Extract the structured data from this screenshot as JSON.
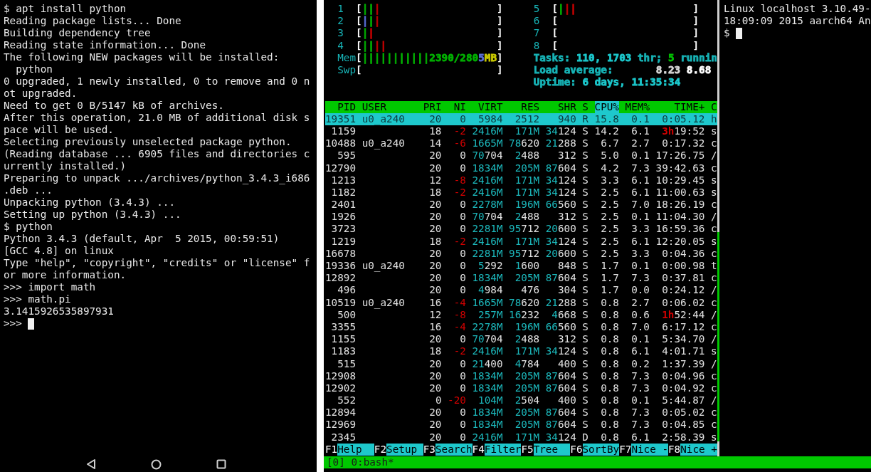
{
  "phone_terminal": {
    "lines": [
      "$ apt install python",
      "Reading package lists... Done",
      "Building dependency tree",
      "Reading state information... Done",
      "The following NEW packages will be installed:",
      "  python",
      "0 upgraded, 1 newly installed, 0 to remove and 0 n",
      "ot upgraded.",
      "Need to get 0 B/5147 kB of archives.",
      "After this operation, 21.0 MB of additional disk s",
      "pace will be used.",
      "Selecting previously unselected package python.",
      "(Reading database ... 6905 files and directories c",
      "urrently installed.)",
      "Preparing to unpack .../archives/python_3.4.3_i686",
      ".deb ...",
      "Unpacking python (3.4.3) ...",
      "Setting up python (3.4.3) ...",
      "$ python",
      "Python 3.4.3 (default, Apr  5 2015, 00:59:51)",
      "[GCC 4.8] on linux",
      "Type \"help\", \"copyright\", \"credits\" or \"license\" f",
      "or more information.",
      ">>> import math",
      ">>> math.pi",
      "3.1415926535897931"
    ],
    "prompt": ">>>"
  },
  "htop": {
    "meters_left": [
      {
        "label": "1",
        "open": "[",
        "close": "]",
        "segments": [
          {
            "text": "||",
            "color": "#00b000"
          },
          {
            "text": "|",
            "color": "#c00000"
          }
        ]
      },
      {
        "label": "2",
        "open": "[",
        "close": "]",
        "segments": [
          {
            "text": "|",
            "color": "#5a6ed8"
          },
          {
            "text": "|",
            "color": "#00b000"
          },
          {
            "text": "|",
            "color": "#c00000"
          }
        ]
      },
      {
        "label": "3",
        "open": "[",
        "close": "]",
        "segments": [
          {
            "text": "|",
            "color": "#00b000"
          },
          {
            "text": "|",
            "color": "#c00000"
          }
        ]
      },
      {
        "label": "4",
        "open": "[",
        "close": "]",
        "segments": [
          {
            "text": "||",
            "color": "#00b000"
          },
          {
            "text": "||",
            "color": "#c00000"
          }
        ]
      },
      {
        "label": "Mem",
        "open": "[",
        "close": "]",
        "segments": [
          {
            "text": "|||||||||||2390/280",
            "color": "#00b000"
          },
          {
            "text": "5",
            "color": "#5a6ed8"
          },
          {
            "text": "MB",
            "color": "#c8c800"
          }
        ]
      },
      {
        "label": "Swp",
        "open": "[",
        "close": "]"
      }
    ],
    "meters_right": [
      {
        "label": "5",
        "open": "[",
        "close": "]",
        "segments": [
          {
            "text": "|",
            "color": "#00b000"
          },
          {
            "text": "|",
            "color": "#c00000"
          },
          {
            "text": "|",
            "color": "#c00000"
          }
        ]
      },
      {
        "label": "6",
        "open": "[",
        "close": "]"
      },
      {
        "label": "7",
        "open": "[",
        "close": "]"
      },
      {
        "label": "8",
        "open": "[",
        "close": "]"
      }
    ],
    "summary": [
      {
        "segments": [
          {
            "text": "Tasks: ",
            "color": "#17b3b6"
          },
          {
            "text": "110, 1703",
            "color": "#1cc8cc"
          },
          {
            "text": " thr; ",
            "color": "#17b3b6"
          },
          {
            "text": "5",
            "color": "#00c000"
          },
          {
            "text": " runnin",
            "color": "#17b3b6"
          }
        ]
      },
      {
        "segments": [
          {
            "text": "Load average: ",
            "color": "#17b3b6"
          },
          {
            "text": "      8.23 ",
            "color": "#d8d8d8"
          },
          {
            "text": "8.68",
            "color": "#ffffff"
          }
        ]
      },
      {
        "segments": [
          {
            "text": "Uptime: ",
            "color": "#17b3b6"
          },
          {
            "text": "6 days, 11:35:34",
            "color": "#1cc8cc"
          }
        ]
      }
    ],
    "table": {
      "columns": [
        {
          "label": "PID",
          "selected": false
        },
        {
          "label": "USER",
          "selected": false
        },
        {
          "label": "PRI",
          "selected": false
        },
        {
          "label": "NI",
          "selected": false
        },
        {
          "label": "VIRT",
          "selected": false
        },
        {
          "label": "RES",
          "selected": false
        },
        {
          "label": "SHR",
          "selected": false
        },
        {
          "label": "S",
          "selected": false
        },
        {
          "label": "CPU%",
          "selected": true
        },
        {
          "label": "MEM%",
          "selected": false
        },
        {
          "label": "TIME+",
          "selected": false
        },
        {
          "label": "C",
          "selected": false
        }
      ],
      "rows": [
        {
          "pid": "19351",
          "user": "u0_a240",
          "pri": "20",
          "ni": "0",
          "virt": "5984",
          "res": "2512",
          "shr": "940",
          "state": "R",
          "cpu": "15.8",
          "mem": "0.1",
          "time": "0:05.12",
          "column_12": "h",
          "selected": true
        },
        {
          "pid": "1159",
          "pri": "18",
          "ni": "-2",
          "virt": "2416M",
          "res": "171M",
          "shr": "34124",
          "state": "S",
          "cpu": "14.2",
          "mem": "6.1",
          "time": "3h19:52",
          "column_12": "s",
          "selected": false
        },
        {
          "pid": "10488",
          "user": "u0_a240",
          "pri": "14",
          "ni": "-6",
          "virt": "1665M",
          "res": "78620",
          "shr": "21288",
          "state": "S",
          "cpu": "6.7",
          "mem": "2.7",
          "time": "0:17.32",
          "column_12": "c",
          "selected": false
        },
        {
          "pid": "595",
          "pri": "20",
          "ni": "0",
          "virt": "70704",
          "res": "2488",
          "shr": "312",
          "state": "S",
          "cpu": "5.0",
          "mem": "0.1",
          "time": "17:26.75",
          "column_12": "/",
          "selected": false
        },
        {
          "pid": "12790",
          "pri": "20",
          "ni": "0",
          "virt": "1834M",
          "res": "205M",
          "shr": "87604",
          "state": "S",
          "cpu": "4.2",
          "mem": "7.3",
          "time": "39:42.63",
          "column_12": "c",
          "selected": false
        },
        {
          "pid": "1213",
          "pri": "12",
          "ni": "-8",
          "virt": "2416M",
          "res": "171M",
          "shr": "34124",
          "state": "S",
          "cpu": "3.3",
          "mem": "6.1",
          "time": "10:29.45",
          "column_12": "s",
          "selected": false
        },
        {
          "pid": "1182",
          "pri": "18",
          "ni": "-2",
          "virt": "2416M",
          "res": "171M",
          "shr": "34124",
          "state": "S",
          "cpu": "2.5",
          "mem": "6.1",
          "time": "11:00.63",
          "column_12": "s",
          "selected": false
        },
        {
          "pid": "2401",
          "pri": "20",
          "ni": "0",
          "virt": "2278M",
          "res": "196M",
          "shr": "66560",
          "state": "S",
          "cpu": "2.5",
          "mem": "7.0",
          "time": "18:26.19",
          "column_12": "c",
          "selected": false
        },
        {
          "pid": "1926",
          "pri": "20",
          "ni": "0",
          "virt": "70704",
          "res": "2488",
          "shr": "312",
          "state": "S",
          "cpu": "2.5",
          "mem": "0.1",
          "time": "11:04.30",
          "column_12": "/",
          "selected": false
        },
        {
          "pid": "3723",
          "pri": "20",
          "ni": "0",
          "virt": "2281M",
          "res": "95712",
          "shr": "20600",
          "state": "S",
          "cpu": "2.5",
          "mem": "3.3",
          "time": "16:59.36",
          "column_12": "c",
          "selected": false
        },
        {
          "pid": "1219",
          "pri": "18",
          "ni": "-2",
          "virt": "2416M",
          "res": "171M",
          "shr": "34124",
          "state": "S",
          "cpu": "2.5",
          "mem": "6.1",
          "time": "12:20.05",
          "column_12": "s",
          "selected": false
        },
        {
          "pid": "16678",
          "pri": "20",
          "ni": "0",
          "virt": "2281M",
          "res": "95712",
          "shr": "20600",
          "state": "S",
          "cpu": "2.5",
          "mem": "3.3",
          "time": "0:04.36",
          "column_12": "c",
          "selected": false
        },
        {
          "pid": "19336",
          "user": "u0_a240",
          "pri": "20",
          "ni": "0",
          "virt": "5292",
          "res": "1600",
          "shr": "848",
          "state": "S",
          "cpu": "1.7",
          "mem": "0.1",
          "time": "0:00.98",
          "column_12": "t",
          "selected": false
        },
        {
          "pid": "12892",
          "pri": "20",
          "ni": "0",
          "virt": "1834M",
          "res": "205M",
          "shr": "87604",
          "state": "S",
          "cpu": "1.7",
          "mem": "7.3",
          "time": "0:37.81",
          "column_12": "c",
          "selected": false
        },
        {
          "pid": "496",
          "pri": "20",
          "ni": "0",
          "virt": "4984",
          "res": "476",
          "shr": "304",
          "state": "S",
          "cpu": "1.7",
          "mem": "0.0",
          "time": "0:24.12",
          "column_12": "/",
          "selected": false
        },
        {
          "pid": "10519",
          "user": "u0_a240",
          "pri": "16",
          "ni": "-4",
          "virt": "1665M",
          "res": "78620",
          "shr": "21288",
          "state": "S",
          "cpu": "0.8",
          "mem": "2.7",
          "time": "0:06.02",
          "column_12": "c",
          "selected": false
        },
        {
          "pid": "500",
          "pri": "12",
          "ni": "-8",
          "virt": "257M",
          "res": "16232",
          "shr": "4668",
          "state": "S",
          "cpu": "0.8",
          "mem": "0.6",
          "time": "1h52:44",
          "column_12": "/",
          "selected": false
        },
        {
          "pid": "3355",
          "pri": "16",
          "ni": "-4",
          "virt": "2278M",
          "res": "196M",
          "shr": "66560",
          "state": "S",
          "cpu": "0.8",
          "mem": "7.0",
          "time": "6:17.12",
          "column_12": "c",
          "selected": false
        },
        {
          "pid": "1155",
          "pri": "20",
          "ni": "0",
          "virt": "70704",
          "res": "2488",
          "shr": "312",
          "state": "S",
          "cpu": "0.8",
          "mem": "0.1",
          "time": "5:34.70",
          "column_12": "/",
          "selected": false
        },
        {
          "pid": "1183",
          "pri": "18",
          "ni": "-2",
          "virt": "2416M",
          "res": "171M",
          "shr": "34124",
          "state": "S",
          "cpu": "0.8",
          "mem": "6.1",
          "time": "4:01.71",
          "column_12": "s",
          "selected": false
        },
        {
          "pid": "515",
          "pri": "20",
          "ni": "0",
          "virt": "21400",
          "res": "4784",
          "shr": "400",
          "state": "S",
          "cpu": "0.8",
          "mem": "0.2",
          "time": "1:37.39",
          "column_12": "/",
          "selected": false
        },
        {
          "pid": "12908",
          "pri": "20",
          "ni": "0",
          "virt": "1834M",
          "res": "205M",
          "shr": "87604",
          "state": "S",
          "cpu": "0.8",
          "mem": "7.3",
          "time": "0:04.96",
          "column_12": "c",
          "selected": false
        },
        {
          "pid": "12902",
          "pri": "20",
          "ni": "0",
          "virt": "1834M",
          "res": "205M",
          "shr": "87604",
          "state": "S",
          "cpu": "0.8",
          "mem": "7.3",
          "time": "0:04.92",
          "column_12": "c",
          "selected": false
        },
        {
          "pid": "552",
          "pri": "0",
          "ni": "-20",
          "virt": "104M",
          "res": "2504",
          "shr": "400",
          "state": "S",
          "cpu": "0.8",
          "mem": "0.1",
          "time": "5:44.87",
          "column_12": "/",
          "selected": false
        },
        {
          "pid": "12894",
          "pri": "20",
          "ni": "0",
          "virt": "1834M",
          "res": "205M",
          "shr": "87604",
          "state": "S",
          "cpu": "0.8",
          "mem": "7.3",
          "time": "0:05.02",
          "column_12": "c",
          "selected": false
        },
        {
          "pid": "12969",
          "pri": "20",
          "ni": "0",
          "virt": "1834M",
          "res": "205M",
          "shr": "87604",
          "state": "S",
          "cpu": "0.8",
          "mem": "7.3",
          "time": "0:04.85",
          "column_12": "c",
          "selected": false
        },
        {
          "pid": "2345",
          "pri": "20",
          "ni": "0",
          "virt": "2416M",
          "res": "171M",
          "shr": "34124",
          "state": "D",
          "cpu": "0.8",
          "mem": "6.1",
          "time": "2:58.39",
          "column_12": "s",
          "selected": false
        }
      ]
    },
    "function_keys": [
      {
        "key": "F1",
        "label": "Help"
      },
      {
        "key": "F2",
        "label": "Setup"
      },
      {
        "key": "F3",
        "label": "Search"
      },
      {
        "key": "F4",
        "label": "Filter"
      },
      {
        "key": "F5",
        "label": "Tree"
      },
      {
        "key": "F6",
        "label": "SortBy"
      },
      {
        "key": "F7",
        "label": "Nice -"
      },
      {
        "key": "F8",
        "label": "Nice +"
      }
    ]
  },
  "shell_pane": {
    "lines": [
      "Linux localhost 3.10.49-",
      "18:09:09 2015 aarch64 An"
    ],
    "prompt": "$"
  },
  "status_bar": {
    "text": "[0] 0:bash*"
  }
}
